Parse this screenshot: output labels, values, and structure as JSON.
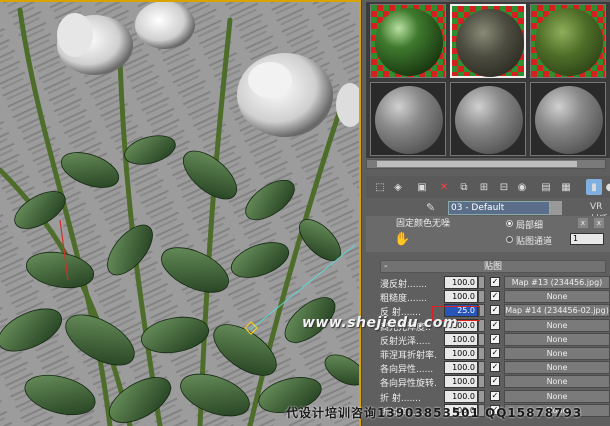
{
  "material_editor": {
    "material_name": "03 - Default",
    "renderer_label": "VR材质",
    "colors": {
      "panel_bg": "#5f5f5f",
      "highlight_value": "#2855b8",
      "selection_box": "#e02020",
      "viewport_border": "#d9a400"
    },
    "options": {
      "cut_text": "固定颜色无噪",
      "local_label": "局部细",
      "map_channel_label": "贴图通道",
      "map_channel_value": "1"
    },
    "slots": [
      {
        "name": "slot-1",
        "look": "green-glossy"
      },
      {
        "name": "slot-2",
        "look": "dark-stone"
      },
      {
        "name": "slot-3",
        "look": "moss-green"
      },
      {
        "name": "slot-4",
        "look": "grey-default"
      },
      {
        "name": "slot-5",
        "look": "grey-default"
      },
      {
        "name": "slot-6",
        "look": "grey-default"
      }
    ],
    "maps_rollout": {
      "title": "贴图",
      "rows": [
        {
          "label": "漫反射.......",
          "value": "100.0",
          "checked": true,
          "map": "Map #13 (234456.jpg)"
        },
        {
          "label": "粗糙度.......",
          "value": "100.0",
          "checked": true,
          "map": "None"
        },
        {
          "label": "反 射.......",
          "value": "25.0",
          "checked": true,
          "map": "Map #14 (234456-02.jpg)",
          "highlight": true
        },
        {
          "label": "高光光泽度..",
          "value": "100.0",
          "checked": true,
          "map": "None"
        },
        {
          "label": "反射光泽.....",
          "value": "100.0",
          "checked": true,
          "map": "None"
        },
        {
          "label": "菲涅耳折射率.",
          "value": "100.0",
          "checked": true,
          "map": "None"
        },
        {
          "label": "各向异性......",
          "value": "100.0",
          "checked": true,
          "map": "None"
        },
        {
          "label": "各向异性旋转.",
          "value": "100.0",
          "checked": true,
          "map": "None"
        },
        {
          "label": "折 射.......",
          "value": "100.0",
          "checked": true,
          "map": "None"
        },
        {
          "label": "折射率......",
          "value": "100.0",
          "checked": true,
          "map": "None"
        }
      ]
    }
  },
  "overlays": {
    "watermark": "www.shejiedu.com",
    "footer": "代设计培训咨询13903853501 QQ15878793"
  }
}
